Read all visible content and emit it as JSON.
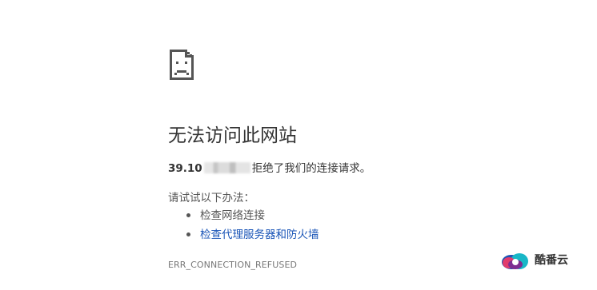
{
  "error_page": {
    "icon": "sad-document-icon",
    "title": "无法访问此网站",
    "host_visible": "39.10",
    "host_obscured": true,
    "refusal_text": "拒绝了我们的连接请求。",
    "try_label": "请试试以下办法：",
    "suggestions": [
      {
        "label": "检查网络连接",
        "is_link": false
      },
      {
        "label": "检查代理服务器和防火墙",
        "is_link": true
      }
    ],
    "error_code": "ERR_CONNECTION_REFUSED"
  },
  "watermark": {
    "logo_icon": "cloud-logo-icon",
    "text": "酷番云"
  },
  "colors": {
    "text": "#333333",
    "secondary_text": "#555555",
    "link": "#1a55b7",
    "error_code": "#777777",
    "background": "#ffffff"
  }
}
